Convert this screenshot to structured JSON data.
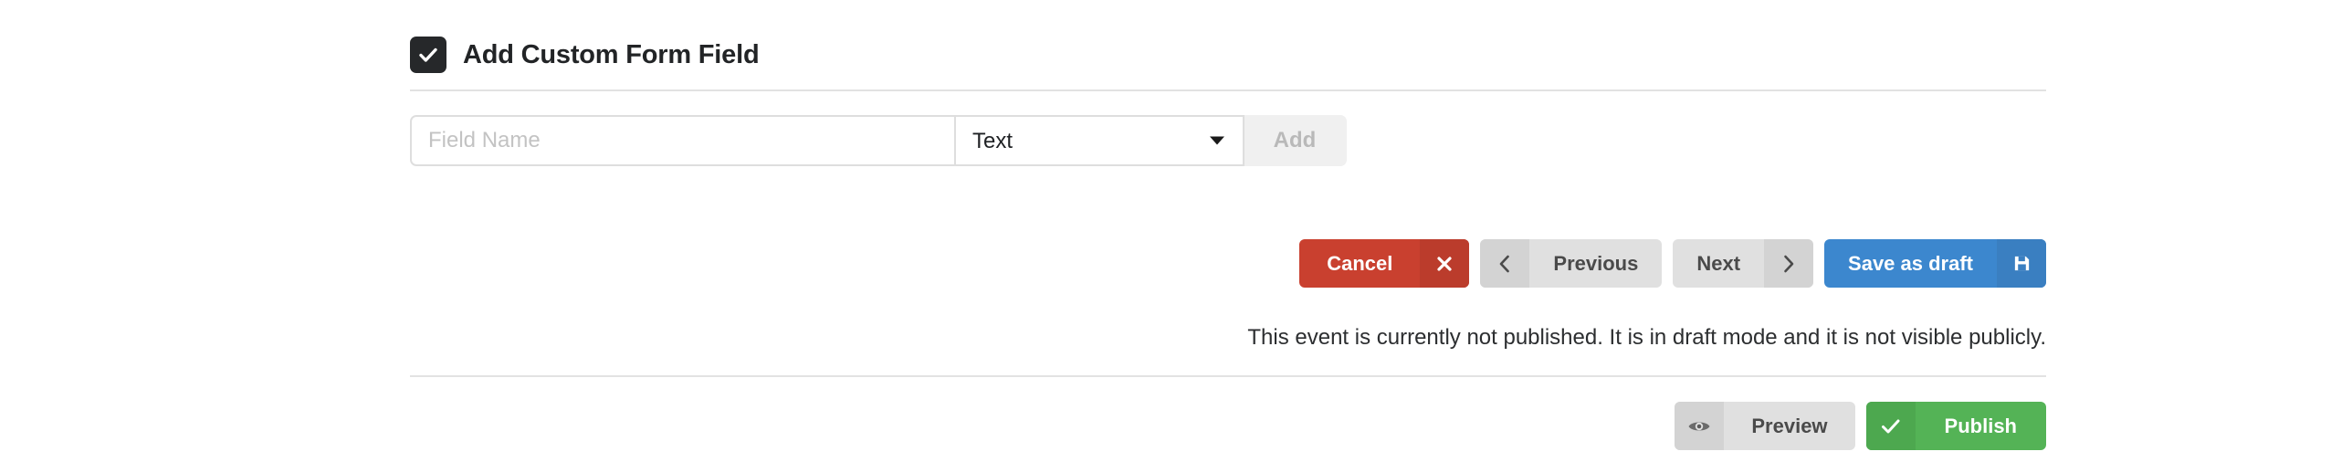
{
  "section": {
    "title": "Add Custom Form Field",
    "checkbox_checked": true,
    "checkbox_icon": "check-icon"
  },
  "form": {
    "field_name": {
      "value": "",
      "placeholder": "Field Name"
    },
    "field_type": {
      "selected": "Text",
      "caret_icon": "chevron-down-icon"
    },
    "add_label": "Add"
  },
  "actions": {
    "cancel": {
      "label": "Cancel",
      "icon": "close-icon",
      "color": "#c9402f"
    },
    "previous": {
      "label": "Previous",
      "icon": "chevron-left-icon",
      "color": "#e0e0e0"
    },
    "next": {
      "label": "Next",
      "icon": "chevron-right-icon",
      "color": "#e0e0e0"
    },
    "save_draft": {
      "label": "Save as draft",
      "icon": "save-disk-icon",
      "color": "#3c87ce"
    }
  },
  "status": {
    "message": "This event is currently not published. It is in draft mode and it is not visible publicly."
  },
  "publish_bar": {
    "preview": {
      "label": "Preview",
      "icon": "eye-icon",
      "color": "#e0e0e0"
    },
    "publish": {
      "label": "Publish",
      "icon": "check-icon",
      "color": "#54b356"
    }
  }
}
